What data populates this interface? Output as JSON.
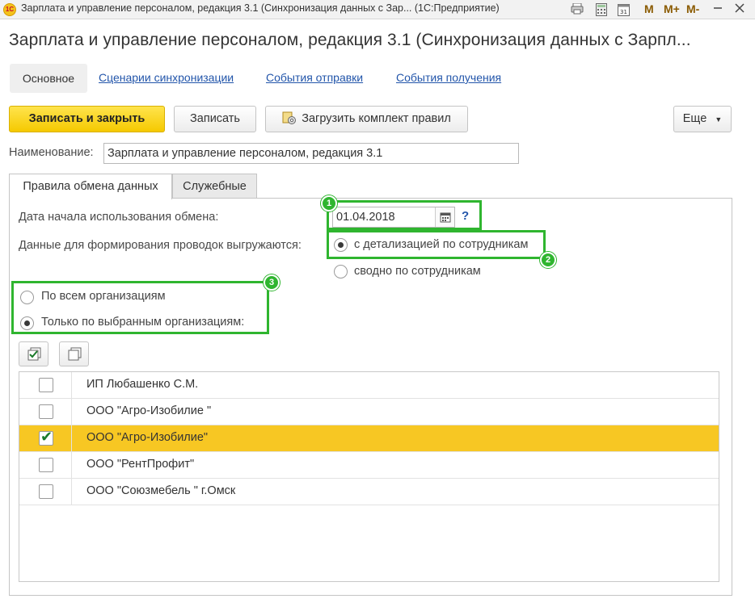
{
  "window": {
    "title": "Зарплата и управление персоналом, редакция 3.1 (Синхронизация данных с Зар... (1С:Предприятие)",
    "m_buttons": [
      "M",
      "M+",
      "M-"
    ]
  },
  "page": {
    "title": "Зарплата и управление персоналом, редакция 3.1 (Синхронизация данных с Зарпл..."
  },
  "nav": {
    "tabs": [
      "Основное",
      "Сценарии синхронизации",
      "События отправки",
      "События получения"
    ]
  },
  "toolbar": {
    "save_close": "Записать и закрыть",
    "save": "Записать",
    "load_rules": "Загрузить комплект правил",
    "more": "Еще"
  },
  "name_field": {
    "label": "Наименование:",
    "value": "Зарплата и управление персоналом, редакция 3.1"
  },
  "tabs": {
    "exchange_rules": "Правила обмена данных",
    "service": "Служебные"
  },
  "form": {
    "start_date_label": "Дата начала использования обмена:",
    "start_date_value": "01.04.2018",
    "help": "?",
    "export_label": "Данные для формирования проводок выгружаются:",
    "export_option_detailed": "с детализацией по сотрудникам",
    "export_option_summary": "сводно по сотрудникам",
    "org_option_all": "По всем организациям",
    "org_option_selected": "Только по выбранным организациям:"
  },
  "badges": [
    "1",
    "2",
    "3"
  ],
  "organizations": [
    {
      "name": "ИП Любашенко С.М.",
      "checked": false,
      "selected": false
    },
    {
      "name": "ООО \"Агро-Изобилие \"",
      "checked": false,
      "selected": false
    },
    {
      "name": "ООО \"Агро-Изобилие\"",
      "checked": true,
      "selected": true
    },
    {
      "name": "ООО \"РентПрофит\"",
      "checked": false,
      "selected": false
    },
    {
      "name": "ООО \"Союзмебель \" г.Омск",
      "checked": false,
      "selected": false
    }
  ],
  "colors": {
    "accent_yellow": "#f5c900",
    "highlight_green": "#2fb52f",
    "link_blue": "#2255aa",
    "selected_row": "#f7c723"
  },
  "icons": {
    "check": "✔",
    "calendar": "calendar-icon"
  }
}
